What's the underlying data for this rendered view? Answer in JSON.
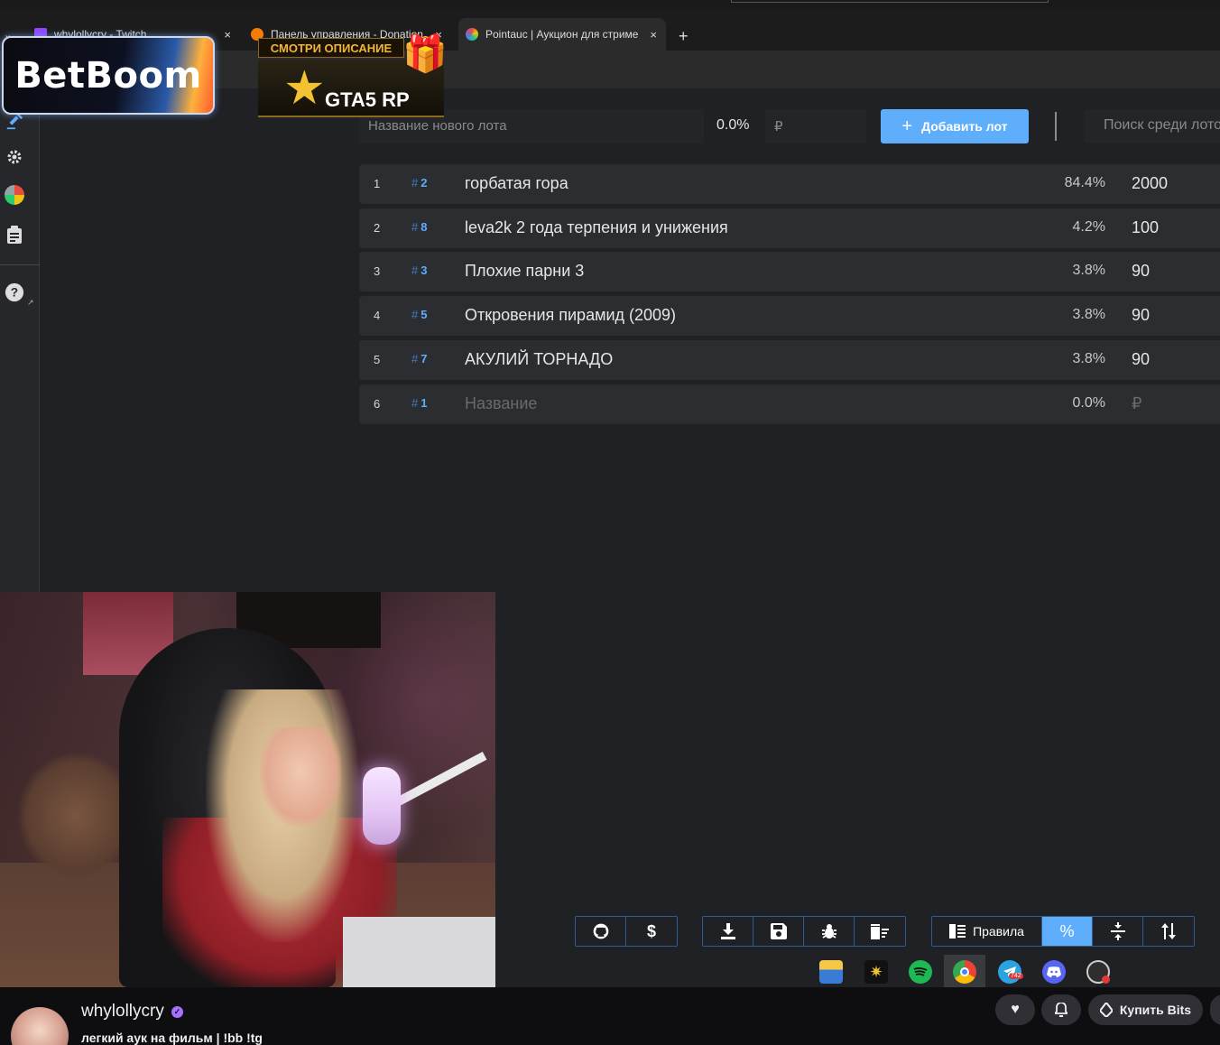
{
  "browser": {
    "tabs": [
      {
        "title": "whylollycry - Twitch",
        "close": "×"
      },
      {
        "title": "Панель управления - Donation",
        "close": "×"
      },
      {
        "title": "Pointauc | Аукцион для стриме",
        "close": "×"
      }
    ],
    "new_tab": "+",
    "tab_list": "⌄"
  },
  "overlays": {
    "betboom": "BetBoom",
    "gta_banner_top": "СМОТРИ ОПИСАНИЕ",
    "gta_banner_main": "GTA5 RP"
  },
  "add_form": {
    "lot_name_placeholder": "Название нового лота",
    "percent": "0.0%",
    "amount_placeholder": "₽",
    "add_button": "Добавить лот",
    "search_placeholder": "Поиск среди лотов"
  },
  "lots": [
    {
      "num": "1",
      "id": "2",
      "name": "горбатая гора",
      "percent": "84.4%",
      "amount": "2000"
    },
    {
      "num": "2",
      "id": "8",
      "name": "leva2k 2 года терпения и унижения",
      "percent": "4.2%",
      "amount": "100"
    },
    {
      "num": "3",
      "id": "3",
      "name": "Плохие парни 3",
      "percent": "3.8%",
      "amount": "90"
    },
    {
      "num": "4",
      "id": "5",
      "name": "Откровения пирамид (2009)",
      "percent": "3.8%",
      "amount": "90"
    },
    {
      "num": "5",
      "id": "7",
      "name": "АКУЛИЙ ТОРНАДО",
      "percent": "3.8%",
      "amount": "90"
    },
    {
      "num": "6",
      "id": "1",
      "name": "Название",
      "percent": "0.0%",
      "amount": "₽"
    }
  ],
  "hash_symbol": "#",
  "controls": {
    "rules_label": "Правила",
    "percent_label": "%"
  },
  "stream": {
    "channel": "whylollycry",
    "title": "легкий аук на фильм | !bb !tg",
    "buy_bits": "Купить Bits",
    "telegram_badge": "742"
  },
  "colors": {
    "accent": "#5eaefc",
    "background": "#202124",
    "row": "#2c2d30",
    "twitch_purple": "#a970ff"
  },
  "icons": [
    "github-icon",
    "dollar-icon",
    "download-icon",
    "save-icon",
    "bug-icon",
    "trash-icon",
    "rules-icon",
    "percent-icon",
    "compress-icon",
    "sort-icon",
    "settings-icon",
    "pie-chart-icon",
    "clipboard-icon",
    "help-icon",
    "search-icon",
    "plus-icon",
    "heart-icon",
    "bell-icon",
    "bits-icon"
  ]
}
